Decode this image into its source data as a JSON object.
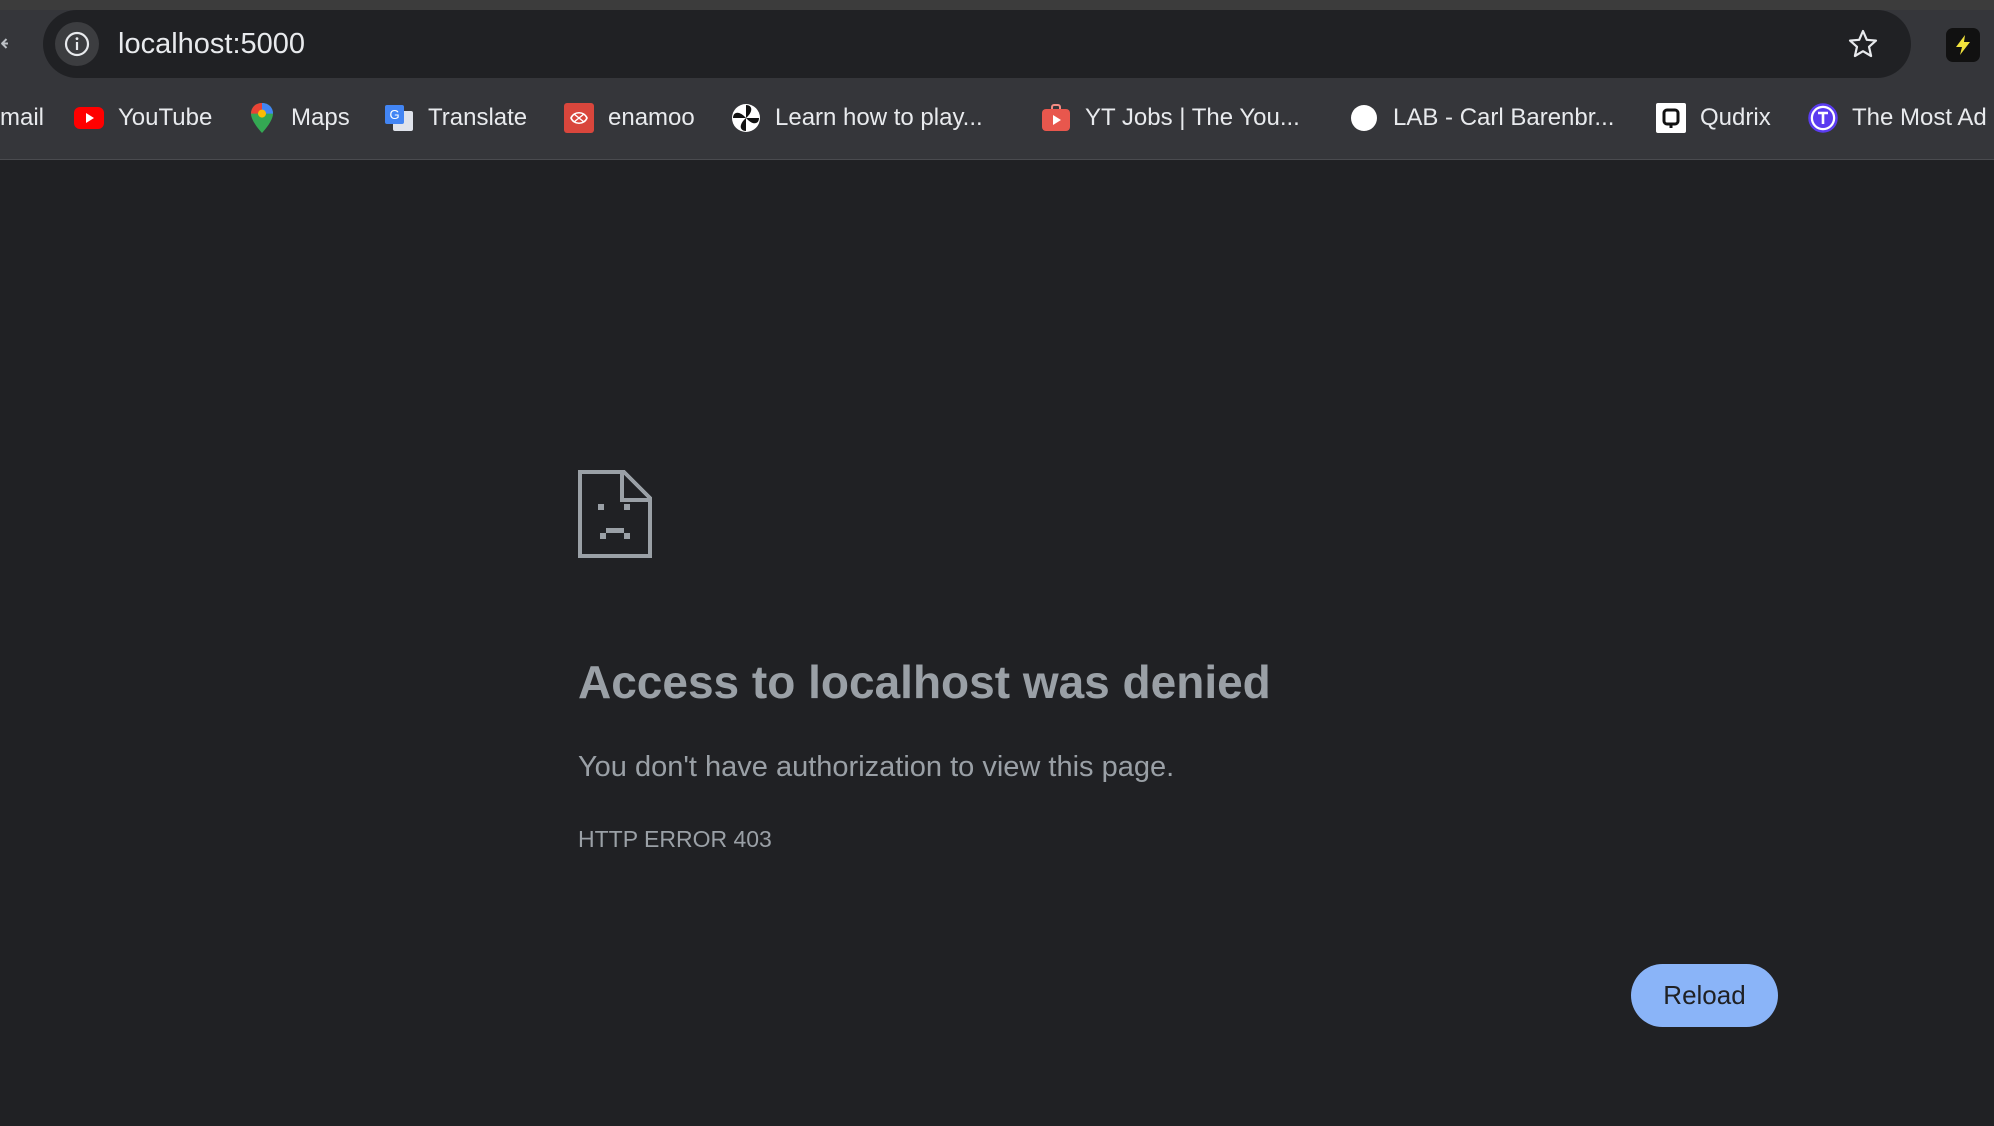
{
  "browser": {
    "url": "localhost:5000",
    "bookmarks": [
      {
        "label": "mail",
        "icon": "gmail-icon"
      },
      {
        "label": "YouTube",
        "icon": "youtube-icon"
      },
      {
        "label": "Maps",
        "icon": "maps-pin-icon"
      },
      {
        "label": "Translate",
        "icon": "translate-icon"
      },
      {
        "label": "enamoo",
        "icon": "enamoo-icon"
      },
      {
        "label": "Learn how to play...",
        "icon": "pinwheel-icon"
      },
      {
        "label": "YT Jobs | The You...",
        "icon": "yt-jobs-icon"
      },
      {
        "label": "LAB - Carl Barenbr...",
        "icon": "white-circle-icon"
      },
      {
        "label": "Qudrix",
        "icon": "qudrix-icon"
      },
      {
        "label": "The Most Ad",
        "icon": "t-circle-icon"
      }
    ],
    "colors": {
      "accent": "#8ab4f8",
      "background": "#202124",
      "toolbar": "#35363a"
    }
  },
  "error_page": {
    "title": "Access to localhost was denied",
    "subtitle": "You don't have authorization to view this page.",
    "error_code": "HTTP ERROR 403",
    "reload_label": "Reload",
    "icon": "sad-page-icon"
  }
}
